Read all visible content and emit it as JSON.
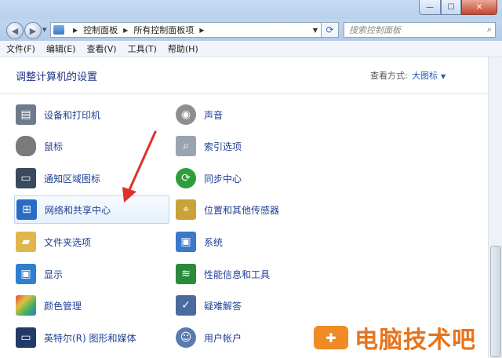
{
  "window": {
    "controls": {
      "minimize": "—",
      "maximize": "☐",
      "close": "✕"
    }
  },
  "nav": {
    "back_icon": "back-arrow-icon",
    "forward_icon": "forward-arrow-icon",
    "breadcrumb": [
      "控制面板",
      "所有控制面板项"
    ],
    "search_placeholder": "搜索控制面板"
  },
  "menu": [
    "文件(F)",
    "编辑(E)",
    "查看(V)",
    "工具(T)",
    "帮助(H)"
  ],
  "content": {
    "title": "调整计算机的设置",
    "view_by_label": "查看方式:",
    "view_by_value": "大图标"
  },
  "items": [
    {
      "label": "设备和打印机",
      "icon": "printer-icon",
      "color": "#6d7b8c"
    },
    {
      "label": "声音",
      "icon": "speaker-icon",
      "color": "#8e8e8e"
    },
    {
      "label": "鼠标",
      "icon": "mouse-icon",
      "color": "#7a7a7a"
    },
    {
      "label": "索引选项",
      "icon": "magnifier-icon",
      "color": "#9aa4b0"
    },
    {
      "label": "通知区域图标",
      "icon": "taskbar-icon",
      "color": "#3a4a5c"
    },
    {
      "label": "同步中心",
      "icon": "sync-icon",
      "color": "#2e9d3a"
    },
    {
      "label": "网络和共享中心",
      "icon": "network-icon",
      "color": "#2a6cc4"
    },
    {
      "label": "位置和其他传感器",
      "icon": "location-icon",
      "color": "#c9a23a"
    },
    {
      "label": "文件夹选项",
      "icon": "folder-icon",
      "color": "#e0b64b"
    },
    {
      "label": "系统",
      "icon": "computer-icon",
      "color": "#3a78c8"
    },
    {
      "label": "显示",
      "icon": "monitor-icon",
      "color": "#2f7fd0"
    },
    {
      "label": "性能信息和工具",
      "icon": "performance-icon",
      "color": "#2a8a3a"
    },
    {
      "label": "颜色管理",
      "icon": "color-management-icon",
      "color": "#c94d8e"
    },
    {
      "label": "疑难解答",
      "icon": "troubleshoot-icon",
      "color": "#4a6aa0"
    },
    {
      "label": "英特尔(R) 图形和媒体",
      "icon": "intel-graphics-icon",
      "color": "#243a66"
    },
    {
      "label": "用户帐户",
      "icon": "users-icon",
      "color": "#5a7ab0"
    }
  ],
  "selected_item": "网络和共享中心",
  "watermark": {
    "text": "电脑技术吧",
    "brand_color": "#e8741c"
  }
}
